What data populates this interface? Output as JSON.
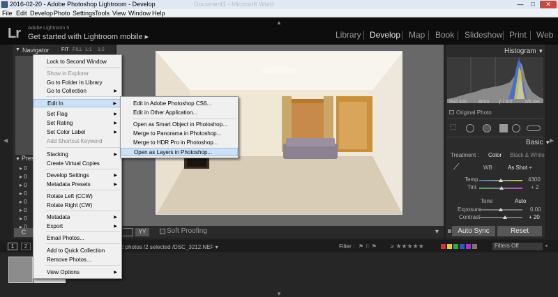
{
  "window": {
    "title": "2016-02-20 - Adobe Photoshop Lightroom - Develop",
    "ghost_title": "Document1 - Microsoft Word",
    "min_label": "—",
    "max_label": "□",
    "close_label": "✕"
  },
  "menubar": [
    "File",
    "Edit",
    "Develop",
    "Photo",
    "Settings",
    "Tools",
    "View",
    "Window",
    "Help"
  ],
  "identity": {
    "logo": "Lr",
    "version": "Adobe Lightroom 5",
    "mobile": "Get started with Lightroom mobile ▸"
  },
  "modules": [
    "Library",
    "Develop",
    "Map",
    "Book",
    "Slideshow",
    "Print",
    "Web"
  ],
  "active_module": "Develop",
  "left_panel": {
    "navigator_label": "Navigator",
    "zoom_options": [
      "FIT",
      "FILL",
      "1:1",
      "1:2"
    ],
    "presets_label": "Presets",
    "preset_rows": [
      "0",
      "0",
      "0",
      "0",
      "0",
      "0",
      "0",
      "0",
      "0"
    ]
  },
  "context_menu": {
    "items": [
      {
        "label": "Lock to Second Window",
        "disabled": false,
        "submenu": false
      },
      {
        "label": "Show in Explorer",
        "disabled": true,
        "submenu": false
      },
      {
        "label": "Go to Folder in Library",
        "disabled": false,
        "submenu": false
      },
      {
        "label": "Go to Collection",
        "disabled": false,
        "submenu": true
      },
      {
        "label": "Edit In",
        "disabled": false,
        "submenu": true,
        "highlighted": true
      },
      {
        "label": "Set Flag",
        "disabled": false,
        "submenu": true
      },
      {
        "label": "Set Rating",
        "disabled": false,
        "submenu": true
      },
      {
        "label": "Set Color Label",
        "disabled": false,
        "submenu": true
      },
      {
        "label": "Add Shortcut Keyword",
        "disabled": true,
        "submenu": false
      },
      {
        "label": "Stacking",
        "disabled": false,
        "submenu": true
      },
      {
        "label": "Create Virtual Copies",
        "disabled": false,
        "submenu": false
      },
      {
        "label": "Develop Settings",
        "disabled": false,
        "submenu": true
      },
      {
        "label": "Metadata Presets",
        "disabled": false,
        "submenu": true
      },
      {
        "label": "Rotate Left (CCW)",
        "disabled": false,
        "submenu": false
      },
      {
        "label": "Rotate Right (CW)",
        "disabled": false,
        "submenu": false
      },
      {
        "label": "Metadata",
        "disabled": false,
        "submenu": true
      },
      {
        "label": "Export",
        "disabled": false,
        "submenu": true
      },
      {
        "label": "Email Photos...",
        "disabled": false,
        "submenu": false
      },
      {
        "label": "Add to Quick Collection",
        "disabled": false,
        "submenu": false
      },
      {
        "label": "Remove Photos...",
        "disabled": false,
        "submenu": false
      },
      {
        "label": "View Options",
        "disabled": false,
        "submenu": true
      }
    ]
  },
  "submenu": {
    "items": [
      "Edit in Adobe Photoshop CS6...",
      "Edit in Other Application...",
      "Open as Smart Object in Photoshop...",
      "Merge to Panorama in Photoshop...",
      "Merge to HDR Pro in Photoshop...",
      "Open as Layers in Photoshop..."
    ],
    "highlighted_index": 5
  },
  "toolbar": {
    "compare_label": "YY",
    "soft_proofing_label": "Soft Proofing",
    "collapse_arrow": "▼"
  },
  "right_panel": {
    "histogram_label": "Histogram",
    "iso": "ISO 400",
    "focal": "8mm",
    "aperture": "ƒ / 9.0",
    "shutter": "1/6 sec",
    "original_photo_label": "Original Photo",
    "basic_label": "Basic",
    "treatment_label": "Treatment :",
    "color_label": "Color",
    "bw_label": "Black & White",
    "wb_label": "WB :",
    "wb_value": "As Shot ÷",
    "temp_label": "Temp",
    "temp_value": "4300",
    "temp_level": 0.5,
    "tint_label": "Tint",
    "tint_value": "+ 2",
    "tint_level": 0.51,
    "tone_label": "Tone",
    "tone_auto": "Auto",
    "exposure_label": "Exposure",
    "exposure_value": "0.00",
    "exposure_level": 0.5,
    "contrast_label": "Contrast",
    "contrast_value": "+ 20",
    "contrast_level": 0.6,
    "auto_sync_label": "Auto Sync",
    "reset_label": "Reset"
  },
  "filmstrip": {
    "page1": "1",
    "page2": "2",
    "info": "2 photos /2 selected /DSC_3212.NEF ▾",
    "filter_label": "Filter :",
    "filters_off": "Filters Off"
  },
  "colors": {
    "accent_highlight": "#cde0f5",
    "panel_bg": "#2b2b2b",
    "center_bg": "#686868"
  }
}
